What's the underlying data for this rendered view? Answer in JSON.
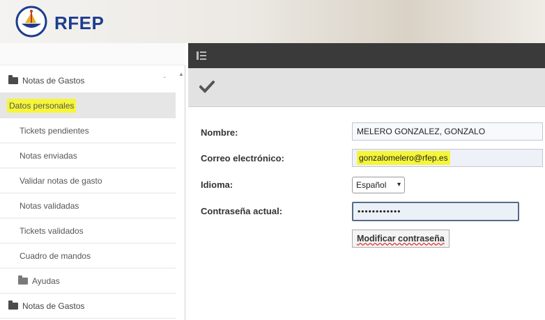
{
  "header": {
    "brand": "RFEP",
    "logo_icon": "rfep-logo-icon"
  },
  "sidebar": {
    "items": [
      {
        "label": "Notas de Gastos",
        "kind": "group",
        "icon": "folder-icon"
      },
      {
        "label": "Datos personales",
        "kind": "item",
        "active": true,
        "highlight": true
      },
      {
        "label": "Tickets pendientes",
        "kind": "item"
      },
      {
        "label": "Notas enviadas",
        "kind": "item"
      },
      {
        "label": "Validar notas de gasto",
        "kind": "item"
      },
      {
        "label": "Notas validadas",
        "kind": "item"
      },
      {
        "label": "Tickets validados",
        "kind": "item"
      },
      {
        "label": "Cuadro de mandos",
        "kind": "item"
      },
      {
        "label": "Ayudas",
        "kind": "subgroup",
        "icon": "folder-icon"
      },
      {
        "label": "Notas de Gastos",
        "kind": "group",
        "icon": "folder-icon"
      }
    ]
  },
  "toolbar": {
    "menu_icon": "menu-icon",
    "save_icon": "checkmark-icon"
  },
  "form": {
    "name_label": "Nombre:",
    "name_value": "MELERO GONZALEZ, GONZALO",
    "email_label": "Correo electrónico:",
    "email_value": "gonzalomelero@rfep.es",
    "language_label": "Idioma:",
    "language_value": "Español",
    "password_label": "Contraseña actual:",
    "password_value": "••••••••••••",
    "change_password_button": "Modificar contraseña"
  },
  "colors": {
    "header_text": "#1e3d8f",
    "topbar": "#3a3a3a",
    "highlight": "#f5f53a"
  }
}
